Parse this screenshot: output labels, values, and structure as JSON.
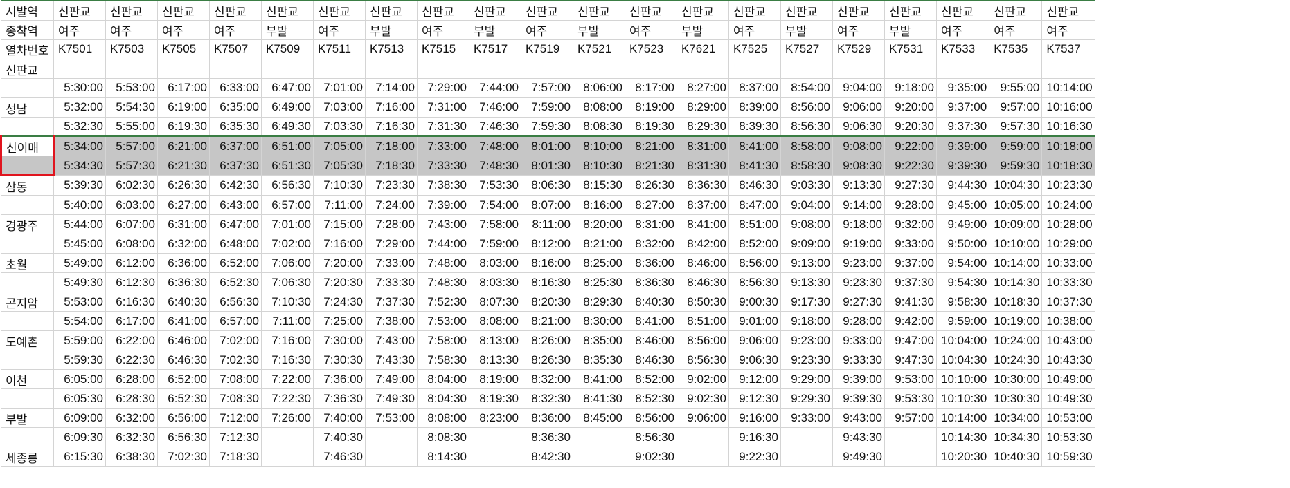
{
  "columns": 21,
  "header_rows": [
    [
      "시발역",
      "신판교",
      "신판교",
      "신판교",
      "신판교",
      "신판교",
      "신판교",
      "신판교",
      "신판교",
      "신판교",
      "신판교",
      "신판교",
      "신판교",
      "신판교",
      "신판교",
      "신판교",
      "신판교",
      "신판교",
      "신판교",
      "신판교",
      "신판교"
    ],
    [
      "종착역",
      "여주",
      "여주",
      "여주",
      "여주",
      "부발",
      "여주",
      "부발",
      "여주",
      "부발",
      "여주",
      "부발",
      "여주",
      "부발",
      "여주",
      "부발",
      "여주",
      "부발",
      "여주",
      "여주",
      "여주"
    ],
    [
      "열차번호",
      "K7501",
      "K7503",
      "K7505",
      "K7507",
      "K7509",
      "K7511",
      "K7513",
      "K7515",
      "K7517",
      "K7519",
      "K7521",
      "K7523",
      "K7621",
      "K7525",
      "K7527",
      "K7529",
      "K7531",
      "K7533",
      "K7535",
      "K7537"
    ]
  ],
  "highlight_station": "신이매",
  "stations": [
    {
      "name": "신판교",
      "times": [
        [
          "",
          "",
          "",
          "",
          "",
          "",
          "",
          "",
          "",
          "",
          "",
          "",
          "",
          "",
          "",
          "",
          "",
          "",
          "",
          ""
        ],
        [
          "5:30:00",
          "5:53:00",
          "6:17:00",
          "6:33:00",
          "6:47:00",
          "7:01:00",
          "7:14:00",
          "7:29:00",
          "7:44:00",
          "7:57:00",
          "8:06:00",
          "8:17:00",
          "8:27:00",
          "8:37:00",
          "8:54:00",
          "9:04:00",
          "9:18:00",
          "9:35:00",
          "9:55:00",
          "10:14:00"
        ]
      ]
    },
    {
      "name": "성남",
      "times": [
        [
          "5:32:00",
          "5:54:30",
          "6:19:00",
          "6:35:00",
          "6:49:00",
          "7:03:00",
          "7:16:00",
          "7:31:00",
          "7:46:00",
          "7:59:00",
          "8:08:00",
          "8:19:00",
          "8:29:00",
          "8:39:00",
          "8:56:00",
          "9:06:00",
          "9:20:00",
          "9:37:00",
          "9:57:00",
          "10:16:00"
        ],
        [
          "5:32:30",
          "5:55:00",
          "6:19:30",
          "6:35:30",
          "6:49:30",
          "7:03:30",
          "7:16:30",
          "7:31:30",
          "7:46:30",
          "7:59:30",
          "8:08:30",
          "8:19:30",
          "8:29:30",
          "8:39:30",
          "8:56:30",
          "9:06:30",
          "9:20:30",
          "9:37:30",
          "9:57:30",
          "10:16:30"
        ]
      ]
    },
    {
      "name": "신이매",
      "times": [
        [
          "5:34:00",
          "5:57:00",
          "6:21:00",
          "6:37:00",
          "6:51:00",
          "7:05:00",
          "7:18:00",
          "7:33:00",
          "7:48:00",
          "8:01:00",
          "8:10:00",
          "8:21:00",
          "8:31:00",
          "8:41:00",
          "8:58:00",
          "9:08:00",
          "9:22:00",
          "9:39:00",
          "9:59:00",
          "10:18:00"
        ],
        [
          "5:34:30",
          "5:57:30",
          "6:21:30",
          "6:37:30",
          "6:51:30",
          "7:05:30",
          "7:18:30",
          "7:33:30",
          "7:48:30",
          "8:01:30",
          "8:10:30",
          "8:21:30",
          "8:31:30",
          "8:41:30",
          "8:58:30",
          "9:08:30",
          "9:22:30",
          "9:39:30",
          "9:59:30",
          "10:18:30"
        ]
      ]
    },
    {
      "name": "삼동",
      "times": [
        [
          "5:39:30",
          "6:02:30",
          "6:26:30",
          "6:42:30",
          "6:56:30",
          "7:10:30",
          "7:23:30",
          "7:38:30",
          "7:53:30",
          "8:06:30",
          "8:15:30",
          "8:26:30",
          "8:36:30",
          "8:46:30",
          "9:03:30",
          "9:13:30",
          "9:27:30",
          "9:44:30",
          "10:04:30",
          "10:23:30"
        ],
        [
          "5:40:00",
          "6:03:00",
          "6:27:00",
          "6:43:00",
          "6:57:00",
          "7:11:00",
          "7:24:00",
          "7:39:00",
          "7:54:00",
          "8:07:00",
          "8:16:00",
          "8:27:00",
          "8:37:00",
          "8:47:00",
          "9:04:00",
          "9:14:00",
          "9:28:00",
          "9:45:00",
          "10:05:00",
          "10:24:00"
        ]
      ]
    },
    {
      "name": "경광주",
      "times": [
        [
          "5:44:00",
          "6:07:00",
          "6:31:00",
          "6:47:00",
          "7:01:00",
          "7:15:00",
          "7:28:00",
          "7:43:00",
          "7:58:00",
          "8:11:00",
          "8:20:00",
          "8:31:00",
          "8:41:00",
          "8:51:00",
          "9:08:00",
          "9:18:00",
          "9:32:00",
          "9:49:00",
          "10:09:00",
          "10:28:00"
        ],
        [
          "5:45:00",
          "6:08:00",
          "6:32:00",
          "6:48:00",
          "7:02:00",
          "7:16:00",
          "7:29:00",
          "7:44:00",
          "7:59:00",
          "8:12:00",
          "8:21:00",
          "8:32:00",
          "8:42:00",
          "8:52:00",
          "9:09:00",
          "9:19:00",
          "9:33:00",
          "9:50:00",
          "10:10:00",
          "10:29:00"
        ]
      ]
    },
    {
      "name": "초월",
      "times": [
        [
          "5:49:00",
          "6:12:00",
          "6:36:00",
          "6:52:00",
          "7:06:00",
          "7:20:00",
          "7:33:00",
          "7:48:00",
          "8:03:00",
          "8:16:00",
          "8:25:00",
          "8:36:00",
          "8:46:00",
          "8:56:00",
          "9:13:00",
          "9:23:00",
          "9:37:00",
          "9:54:00",
          "10:14:00",
          "10:33:00"
        ],
        [
          "5:49:30",
          "6:12:30",
          "6:36:30",
          "6:52:30",
          "7:06:30",
          "7:20:30",
          "7:33:30",
          "7:48:30",
          "8:03:30",
          "8:16:30",
          "8:25:30",
          "8:36:30",
          "8:46:30",
          "8:56:30",
          "9:13:30",
          "9:23:30",
          "9:37:30",
          "9:54:30",
          "10:14:30",
          "10:33:30"
        ]
      ]
    },
    {
      "name": "곤지암",
      "times": [
        [
          "5:53:00",
          "6:16:30",
          "6:40:30",
          "6:56:30",
          "7:10:30",
          "7:24:30",
          "7:37:30",
          "7:52:30",
          "8:07:30",
          "8:20:30",
          "8:29:30",
          "8:40:30",
          "8:50:30",
          "9:00:30",
          "9:17:30",
          "9:27:30",
          "9:41:30",
          "9:58:30",
          "10:18:30",
          "10:37:30"
        ],
        [
          "5:54:00",
          "6:17:00",
          "6:41:00",
          "6:57:00",
          "7:11:00",
          "7:25:00",
          "7:38:00",
          "7:53:00",
          "8:08:00",
          "8:21:00",
          "8:30:00",
          "8:41:00",
          "8:51:00",
          "9:01:00",
          "9:18:00",
          "9:28:00",
          "9:42:00",
          "9:59:00",
          "10:19:00",
          "10:38:00"
        ]
      ]
    },
    {
      "name": "도예촌",
      "times": [
        [
          "5:59:00",
          "6:22:00",
          "6:46:00",
          "7:02:00",
          "7:16:00",
          "7:30:00",
          "7:43:00",
          "7:58:00",
          "8:13:00",
          "8:26:00",
          "8:35:00",
          "8:46:00",
          "8:56:00",
          "9:06:00",
          "9:23:00",
          "9:33:00",
          "9:47:00",
          "10:04:00",
          "10:24:00",
          "10:43:00"
        ],
        [
          "5:59:30",
          "6:22:30",
          "6:46:30",
          "7:02:30",
          "7:16:30",
          "7:30:30",
          "7:43:30",
          "7:58:30",
          "8:13:30",
          "8:26:30",
          "8:35:30",
          "8:46:30",
          "8:56:30",
          "9:06:30",
          "9:23:30",
          "9:33:30",
          "9:47:30",
          "10:04:30",
          "10:24:30",
          "10:43:30"
        ]
      ]
    },
    {
      "name": "이천",
      "times": [
        [
          "6:05:00",
          "6:28:00",
          "6:52:00",
          "7:08:00",
          "7:22:00",
          "7:36:00",
          "7:49:00",
          "8:04:00",
          "8:19:00",
          "8:32:00",
          "8:41:00",
          "8:52:00",
          "9:02:00",
          "9:12:00",
          "9:29:00",
          "9:39:00",
          "9:53:00",
          "10:10:00",
          "10:30:00",
          "10:49:00"
        ],
        [
          "6:05:30",
          "6:28:30",
          "6:52:30",
          "7:08:30",
          "7:22:30",
          "7:36:30",
          "7:49:30",
          "8:04:30",
          "8:19:30",
          "8:32:30",
          "8:41:30",
          "8:52:30",
          "9:02:30",
          "9:12:30",
          "9:29:30",
          "9:39:30",
          "9:53:30",
          "10:10:30",
          "10:30:30",
          "10:49:30"
        ]
      ]
    },
    {
      "name": "부발",
      "times": [
        [
          "6:09:00",
          "6:32:00",
          "6:56:00",
          "7:12:00",
          "7:26:00",
          "7:40:00",
          "7:53:00",
          "8:08:00",
          "8:23:00",
          "8:36:00",
          "8:45:00",
          "8:56:00",
          "9:06:00",
          "9:16:00",
          "9:33:00",
          "9:43:00",
          "9:57:00",
          "10:14:00",
          "10:34:00",
          "10:53:00"
        ],
        [
          "6:09:30",
          "6:32:30",
          "6:56:30",
          "7:12:30",
          "",
          "7:40:30",
          "",
          "8:08:30",
          "",
          "8:36:30",
          "",
          "8:56:30",
          "",
          "9:16:30",
          "",
          "9:43:30",
          "",
          "10:14:30",
          "10:34:30",
          "10:53:30"
        ]
      ]
    },
    {
      "name": "세종릉",
      "times": [
        [
          "6:15:30",
          "6:38:30",
          "7:02:30",
          "7:18:30",
          "",
          "7:46:30",
          "",
          "8:14:30",
          "",
          "8:42:30",
          "",
          "9:02:30",
          "",
          "9:22:30",
          "",
          "9:49:30",
          "",
          "10:20:30",
          "10:40:30",
          "10:59:30"
        ]
      ]
    }
  ]
}
